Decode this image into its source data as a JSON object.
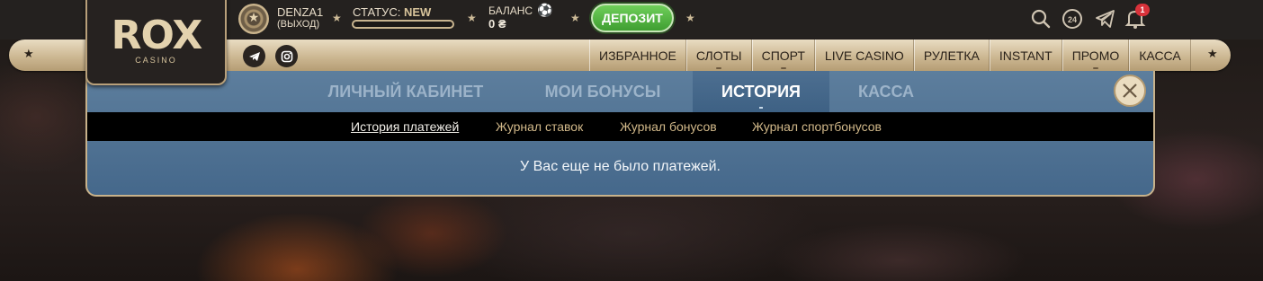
{
  "logo": {
    "brand": "ROX",
    "sub": "CASINO"
  },
  "user": {
    "name": "DENZA1",
    "logout": "(ВЫХОД)"
  },
  "status": {
    "label": "СТАТУС:",
    "value": "NEW",
    "progress_percent": 0
  },
  "balance": {
    "label": "БАЛАНС",
    "value": "0 ₴"
  },
  "deposit_label": "ДЕПОЗИТ",
  "notifications_count": "1",
  "support_label": "24",
  "nav": {
    "items": [
      "ИЗБРАННОЕ",
      "СЛОТЫ",
      "СПОРТ",
      "LIVE CASINO",
      "РУЛЕТКА",
      "INSTANT",
      "ПРОМО",
      "КАССА"
    ]
  },
  "panel": {
    "tabs": [
      "ЛИЧНЫЙ КАБИНЕТ",
      "МОИ БОНУСЫ",
      "ИСТОРИЯ",
      "КАССА"
    ],
    "active_tab": "ИСТОРИЯ",
    "subtabs": [
      "История платежей",
      "Журнал ставок",
      "Журнал бонусов",
      "Журнал спортбонусов"
    ],
    "active_subtab": "История платежей",
    "empty_message": "У Вас еще не было платежей."
  },
  "colors": {
    "accent_gold": "#c8b28b",
    "panel_blue": "#45688b",
    "deposit_green": "#3f9e31",
    "badge_red": "#d8323a"
  }
}
